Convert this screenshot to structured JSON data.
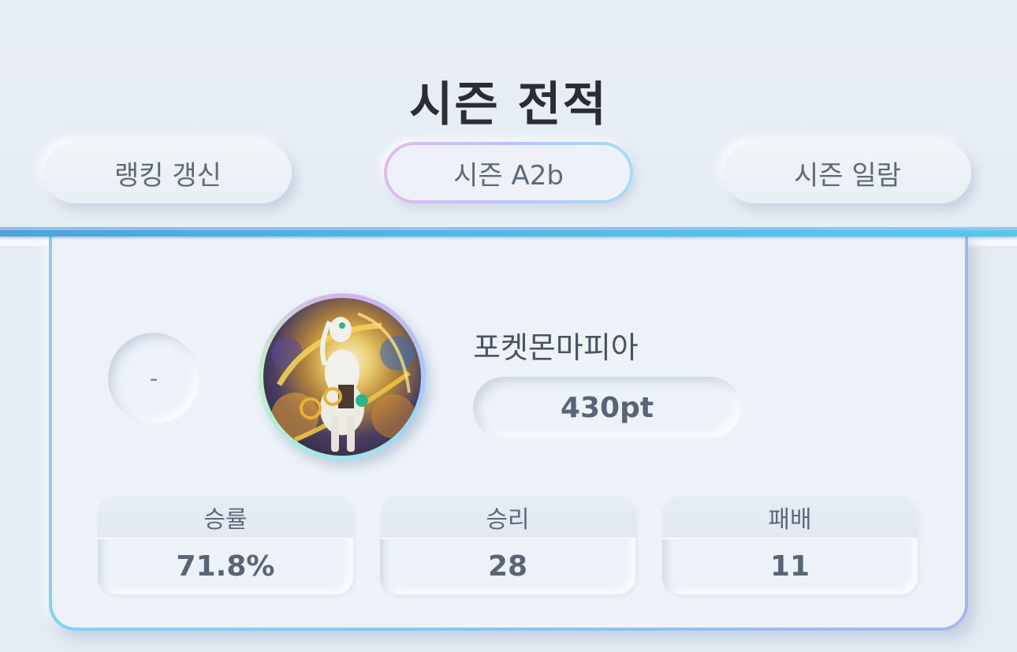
{
  "header": {
    "title": "시즌 전적",
    "tabs": [
      {
        "label": "랭킹 갱신"
      },
      {
        "label": "시즌 A2b"
      },
      {
        "label": "시즌 일람"
      }
    ],
    "active_tab": "시즌 A2b"
  },
  "profile": {
    "rank": "-",
    "avatar_icon": "arceus-avatar",
    "name": "포켓몬마피아",
    "points": "430pt"
  },
  "stats": [
    {
      "label": "승률",
      "value": "71.8%"
    },
    {
      "label": "승리",
      "value": "28"
    },
    {
      "label": "패배",
      "value": "11"
    }
  ],
  "colors": {
    "divider": "#52b6e6",
    "active_tab_border": "#b8c4f8",
    "card_border": "#8cc3ee"
  }
}
